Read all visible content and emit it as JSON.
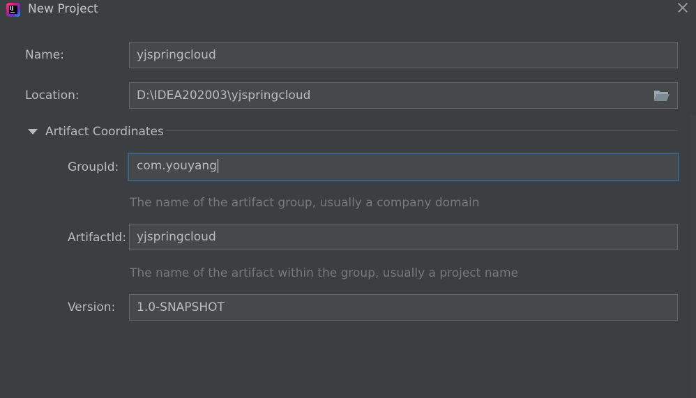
{
  "window": {
    "title": "New Project",
    "app_icon": "intellij-idea-icon",
    "close_icon": "close-icon"
  },
  "form": {
    "name": {
      "label": "Name:",
      "value": "yjspringcloud"
    },
    "location": {
      "label": "Location:",
      "value": "D:\\IDEA202003\\yjspringcloud",
      "browse_icon": "folder-open-icon"
    },
    "artifact_coordinates": {
      "title": "Artifact Coordinates",
      "expanded_icon": "triangle-down-icon",
      "group_id": {
        "label": "GroupId:",
        "value": "com.youyang",
        "hint": "The name of the artifact group, usually a company domain"
      },
      "artifact_id": {
        "label": "ArtifactId:",
        "value": "yjspringcloud",
        "hint": "The name of the artifact within the group, usually a project name"
      },
      "version": {
        "label": "Version:",
        "value": "1.0-SNAPSHOT"
      }
    }
  },
  "colors": {
    "background": "#3c3f41",
    "field_background": "#45494a",
    "focus_border": "#3d6185",
    "text": "#bbbbbb",
    "hint_text": "#787878"
  }
}
